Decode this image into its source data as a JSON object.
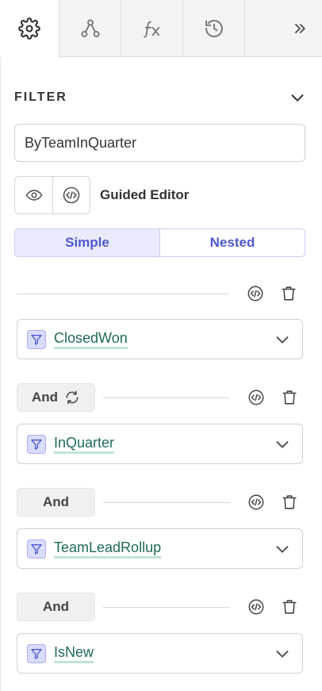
{
  "tabs": [
    {
      "icon": "gear-icon",
      "active": true
    },
    {
      "icon": "graph-nodes-icon",
      "active": false
    },
    {
      "icon": "function-fx-icon",
      "active": false
    },
    {
      "icon": "history-icon",
      "active": false
    },
    {
      "icon": "double-chevron-right-icon",
      "active": false
    }
  ],
  "section": {
    "title": "FILTER"
  },
  "filter_name": {
    "value": "ByTeamInQuarter"
  },
  "editor": {
    "label": "Guided Editor"
  },
  "mode": {
    "simple": "Simple",
    "nested": "Nested",
    "selected": "Simple"
  },
  "conditions": [
    {
      "connector": "",
      "name": "ClosedWon"
    },
    {
      "connector": "And",
      "name": "InQuarter"
    },
    {
      "connector": "And",
      "name": "TeamLeadRollup"
    },
    {
      "connector": "And",
      "name": "IsNew"
    }
  ],
  "colors": {
    "accent": "#4f57d1",
    "link": "#1e6b5a"
  }
}
